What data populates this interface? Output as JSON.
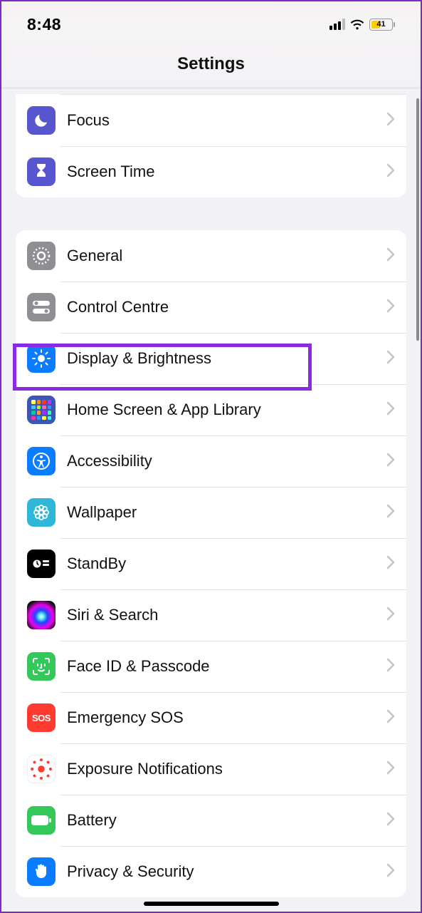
{
  "statusbar": {
    "time": "8:48",
    "battery_percent": "41"
  },
  "navbar": {
    "title": "Settings"
  },
  "groups": [
    {
      "rows": [
        {
          "label": "Focus",
          "icon": "moon-icon",
          "icon_bg": "#5856ce"
        },
        {
          "label": "Screen Time",
          "icon": "hourglass-icon",
          "icon_bg": "#5856ce"
        }
      ]
    },
    {
      "rows": [
        {
          "label": "General",
          "icon": "gear-icon",
          "icon_bg": "#8e8e93"
        },
        {
          "label": "Control Centre",
          "icon": "switches-icon",
          "icon_bg": "#8e8e93"
        },
        {
          "label": "Display & Brightness",
          "icon": "sun-icon",
          "icon_bg": "#0a7cff",
          "highlighted": true
        },
        {
          "label": "Home Screen & App Library",
          "icon": "apps-grid-icon",
          "icon_bg": "#3c55b6"
        },
        {
          "label": "Accessibility",
          "icon": "accessibility-icon",
          "icon_bg": "#0a7cff"
        },
        {
          "label": "Wallpaper",
          "icon": "flower-icon",
          "icon_bg": "#2fb6d8"
        },
        {
          "label": "StandBy",
          "icon": "clock-widget-icon",
          "icon_bg": "#000000"
        },
        {
          "label": "Siri & Search",
          "icon": "siri-icon",
          "icon_bg": "radial"
        },
        {
          "label": "Face ID & Passcode",
          "icon": "faceid-icon",
          "icon_bg": "#34c759"
        },
        {
          "label": "Emergency SOS",
          "icon": "sos-icon",
          "icon_bg": "#ff3b30"
        },
        {
          "label": "Exposure Notifications",
          "icon": "exposure-icon",
          "icon_bg": "#ffffff"
        },
        {
          "label": "Battery",
          "icon": "battery-icon",
          "icon_bg": "#34c759"
        },
        {
          "label": "Privacy & Security",
          "icon": "hand-icon",
          "icon_bg": "#0a7cff"
        }
      ]
    }
  ],
  "highlight_color": "#8a2be2"
}
